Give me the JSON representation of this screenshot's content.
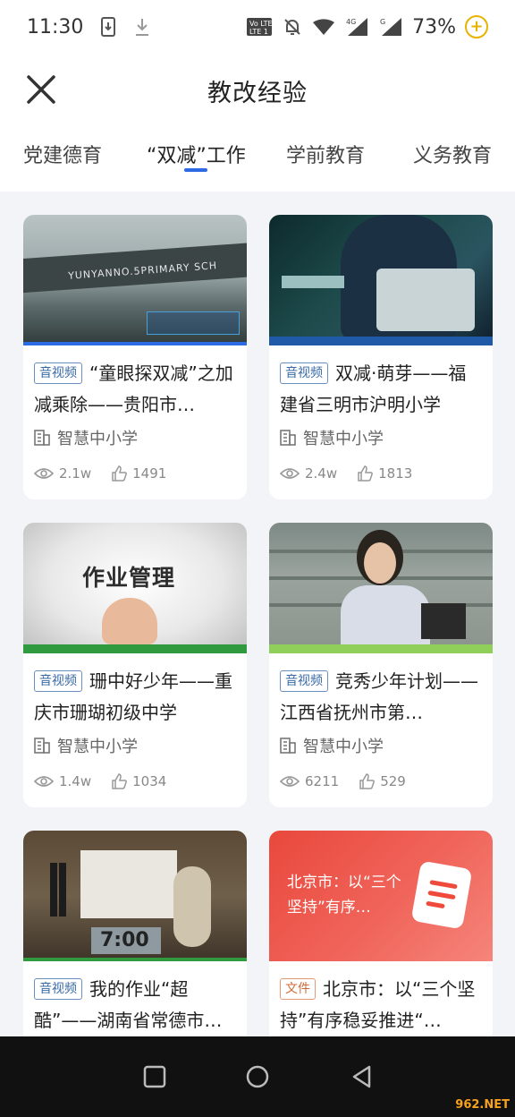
{
  "status_bar": {
    "time": "11:30",
    "battery": "73%"
  },
  "header": {
    "title": "教改经验"
  },
  "tabs": [
    {
      "label": "党建德育"
    },
    {
      "label": "“双减”工作"
    },
    {
      "label": "学前教育"
    },
    {
      "label": "义务教育"
    }
  ],
  "active_tab_index": 1,
  "cards": [
    {
      "tag": "音视频",
      "title": "“童眼探双减”之加减乘除——贵阳市…",
      "source": "智慧中小学",
      "views": "2.1w",
      "likes": "1491",
      "thumb_text": "YUNYANNO.5PRIMARY SCH"
    },
    {
      "tag": "音视频",
      "title": "双减·萌芽——福建省三明市沪明小学",
      "source": "智慧中小学",
      "views": "2.4w",
      "likes": "1813",
      "thumb_text": ""
    },
    {
      "tag": "音视频",
      "title": "珊中好少年——重庆市珊瑚初级中学",
      "source": "智慧中小学",
      "views": "1.4w",
      "likes": "1034",
      "thumb_text": "作业管理"
    },
    {
      "tag": "音视频",
      "title": "竞秀少年计划——江西省抚州市第…",
      "source": "智慧中小学",
      "views": "6211",
      "likes": "529",
      "thumb_text": ""
    },
    {
      "tag": "音视频",
      "title": "我的作业“超酷”——湖南省常德市…",
      "source": "智慧中小学",
      "views": "",
      "likes": "",
      "thumb_text": "7:00"
    },
    {
      "tag": "文件",
      "title": "北京市：以“三个坚持”有序稳妥推进“…",
      "source": "",
      "views": "",
      "likes": "",
      "thumb_text": "北京市：以“三个坚持”有序…"
    }
  ],
  "watermark": "962.NET"
}
